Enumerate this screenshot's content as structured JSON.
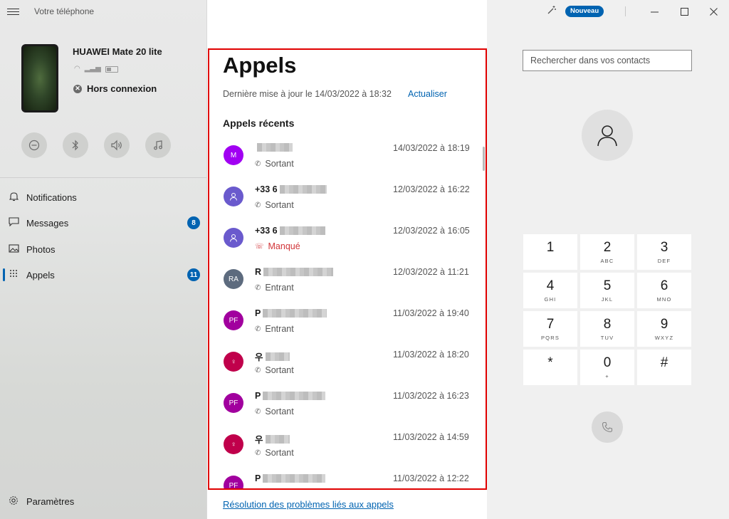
{
  "app": {
    "title": "Votre téléphone"
  },
  "device": {
    "name": "HUAWEI Mate 20 lite",
    "status": "Hors connexion"
  },
  "quick_actions": [
    {
      "icon": "do-not-disturb-icon",
      "glyph": "⊖"
    },
    {
      "icon": "bluetooth-icon",
      "glyph": "ᛒ"
    },
    {
      "icon": "volume-icon",
      "glyph": "🔊"
    },
    {
      "icon": "music-icon",
      "glyph": "♫"
    }
  ],
  "nav": {
    "items": [
      {
        "label": "Notifications",
        "icon": "bell-icon"
      },
      {
        "label": "Messages",
        "icon": "message-icon",
        "badge": "8"
      },
      {
        "label": "Photos",
        "icon": "photo-icon"
      },
      {
        "label": "Appels",
        "icon": "dialpad-icon",
        "badge": "11",
        "active": true
      }
    ],
    "settings_label": "Paramètres"
  },
  "calls": {
    "title": "Appels",
    "last_update": "Dernière mise à jour le 14/03/2022 à 18:32",
    "refresh_label": "Actualiser",
    "recent_label": "Appels récents",
    "items": [
      {
        "initials": "M",
        "avatar_color": "#a100f2",
        "name": "",
        "type": "Sortant",
        "date": "14/03/2022 à 18:19"
      },
      {
        "initials": "",
        "avatar_color": "#6a5acd",
        "name": "+33 6",
        "type": "Sortant",
        "date": "12/03/2022 à 16:22"
      },
      {
        "initials": "",
        "avatar_color": "#6a5acd",
        "name": "+33 6",
        "type": "Manqué",
        "missed": true,
        "date": "12/03/2022 à 16:05"
      },
      {
        "initials": "RA",
        "avatar_color": "#5d6b7e",
        "name": "R",
        "type": "Entrant",
        "date": "12/03/2022 à 11:21"
      },
      {
        "initials": "PF",
        "avatar_color": "#a1009e",
        "name": "P",
        "type": "Entrant",
        "date": "11/03/2022 à 19:40"
      },
      {
        "initials": "♀",
        "avatar_color": "#c0004b",
        "name": "우",
        "type": "Sortant",
        "date": "11/03/2022 à 18:20"
      },
      {
        "initials": "PF",
        "avatar_color": "#a1009e",
        "name": "P",
        "type": "Sortant",
        "date": "11/03/2022 à 16:23"
      },
      {
        "initials": "♀",
        "avatar_color": "#c0004b",
        "name": "우",
        "type": "Sortant",
        "date": "11/03/2022 à 14:59"
      },
      {
        "initials": "PF",
        "avatar_color": "#a1009e",
        "name": "P",
        "type": "",
        "date": "11/03/2022 à 12:22"
      }
    ],
    "troubleshoot_link": "Résolution des problèmes liés aux appels"
  },
  "header": {
    "new_badge": "Nouveau"
  },
  "dialer": {
    "search_placeholder": "Rechercher dans vos contacts",
    "keys": [
      {
        "digit": "1",
        "letters": ""
      },
      {
        "digit": "2",
        "letters": "ABC"
      },
      {
        "digit": "3",
        "letters": "DEF"
      },
      {
        "digit": "4",
        "letters": "GHI"
      },
      {
        "digit": "5",
        "letters": "JKL"
      },
      {
        "digit": "6",
        "letters": "MNO"
      },
      {
        "digit": "7",
        "letters": "PQRS"
      },
      {
        "digit": "8",
        "letters": "TUV"
      },
      {
        "digit": "9",
        "letters": "WXYZ"
      },
      {
        "digit": "*",
        "letters": ""
      },
      {
        "digit": "0",
        "letters": "+"
      },
      {
        "digit": "#",
        "letters": ""
      }
    ]
  },
  "colors": {
    "accent": "#0063b1",
    "missed": "#d13438",
    "highlight_border": "#e00000"
  }
}
